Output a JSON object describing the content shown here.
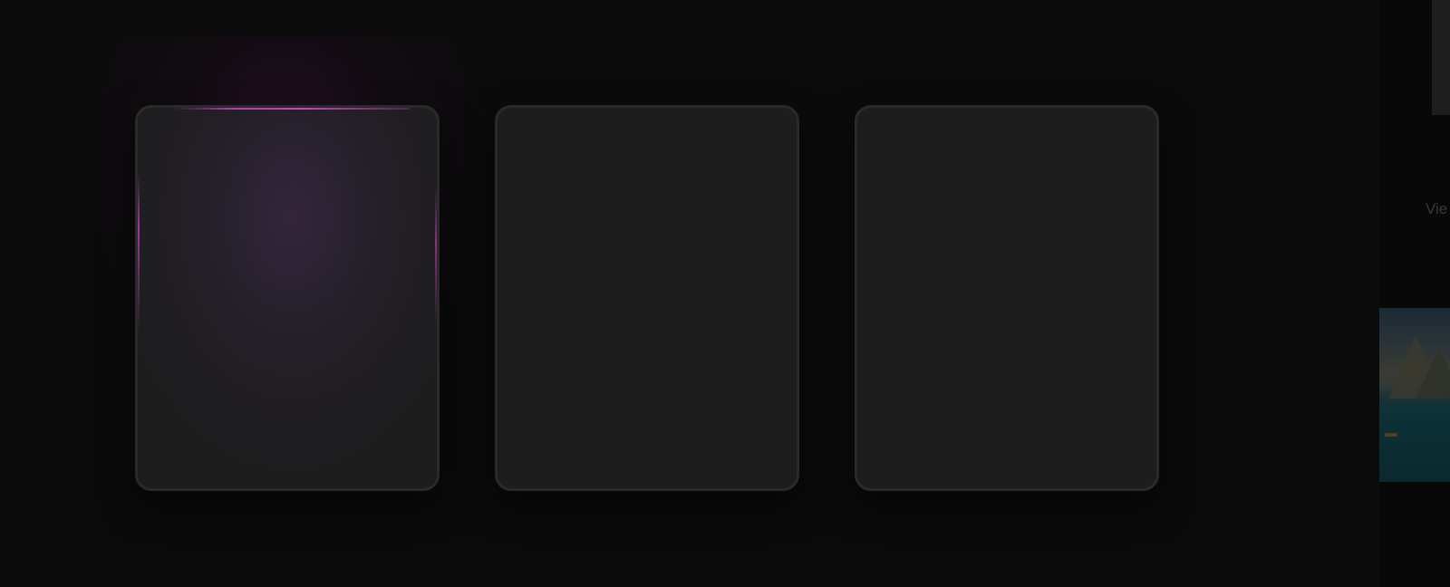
{
  "cards": [
    {
      "id": "card-1",
      "highlighted": true
    },
    {
      "id": "card-2",
      "highlighted": false
    },
    {
      "id": "card-3",
      "highlighted": false
    }
  ],
  "side_panel": {
    "link_label": "Vie"
  },
  "colors": {
    "background": "#0b0b0b",
    "card": "#1d1d1e",
    "card_border": "#2a2a2b",
    "accent_glow": "#c446bd"
  }
}
